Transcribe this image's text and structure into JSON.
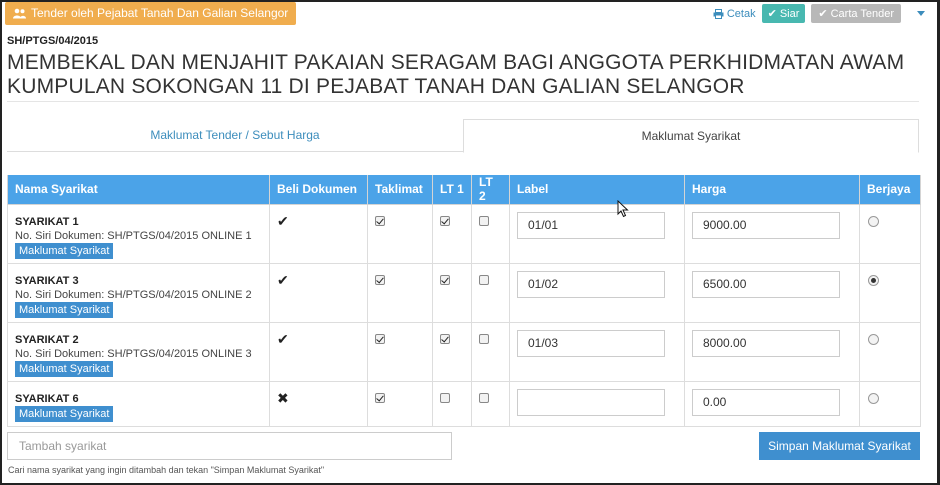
{
  "header": {
    "office_button": "Tender oleh Pejabat Tanah Dan Galian Selangor",
    "print_link": "Cetak",
    "publish_button": "Siar",
    "chart_button": "Carta Tender"
  },
  "tender": {
    "reference": "SH/PTGS/04/2015",
    "title": "MEMBEKAL DAN MENJAHIT PAKAIAN SERAGAM BAGI ANGGOTA PERKHIDMATAN AWAM KUMPULAN SOKONGAN 11 DI PEJABAT TANAH DAN GALIAN SELANGOR"
  },
  "tabs": [
    {
      "label": "Maklumat Tender / Sebut Harga",
      "active": false
    },
    {
      "label": "Maklumat Syarikat",
      "active": true
    }
  ],
  "table": {
    "columns": [
      "Nama Syarikat",
      "Beli Dokumen",
      "Taklimat",
      "LT 1",
      "LT 2",
      "Label",
      "Harga",
      "Berjaya"
    ],
    "rows": [
      {
        "name": "SYARIKAT 1",
        "doc": "No. Siri Dokumen: SH/PTGS/04/2015 ONLINE 1",
        "info_button": "Maklumat Syarikat",
        "bought": true,
        "taklimat": true,
        "lt1": true,
        "lt2": false,
        "label": "01/01",
        "price": "9000.00",
        "winner": false
      },
      {
        "name": "SYARIKAT 3",
        "doc": "No. Siri Dokumen: SH/PTGS/04/2015 ONLINE 2",
        "info_button": "Maklumat Syarikat",
        "bought": true,
        "taklimat": true,
        "lt1": true,
        "lt2": false,
        "label": "01/02",
        "price": "6500.00",
        "winner": true
      },
      {
        "name": "SYARIKAT 2",
        "doc": "No. Siri Dokumen: SH/PTGS/04/2015 ONLINE 3",
        "info_button": "Maklumat Syarikat",
        "bought": true,
        "taklimat": true,
        "lt1": true,
        "lt2": false,
        "label": "01/03",
        "price": "8000.00",
        "winner": false
      },
      {
        "name": "SYARIKAT 6",
        "doc": "",
        "info_button": "Maklumat Syarikat",
        "bought": false,
        "taklimat": true,
        "lt1": false,
        "lt2": false,
        "label": "",
        "price": "0.00",
        "winner": false
      }
    ]
  },
  "footer": {
    "add_placeholder": "Tambah syarikat",
    "save_button": "Simpan Maklumat Syarikat",
    "hint": "Cari nama syarikat yang ingin ditambah dan tekan \"Simpan Maklumat Syarikat\""
  },
  "icons": {
    "office": "users-icon",
    "print": "print-icon",
    "publish": "check-icon",
    "chart": "check-icon",
    "more": "caret-down-icon"
  },
  "colors": {
    "accent": "#3f8fcf",
    "header_blue": "#4ba3e8",
    "office_orange": "#f0ad4e",
    "publish_teal": "#48b8b0",
    "disabled_grey": "#b8b8b8"
  }
}
